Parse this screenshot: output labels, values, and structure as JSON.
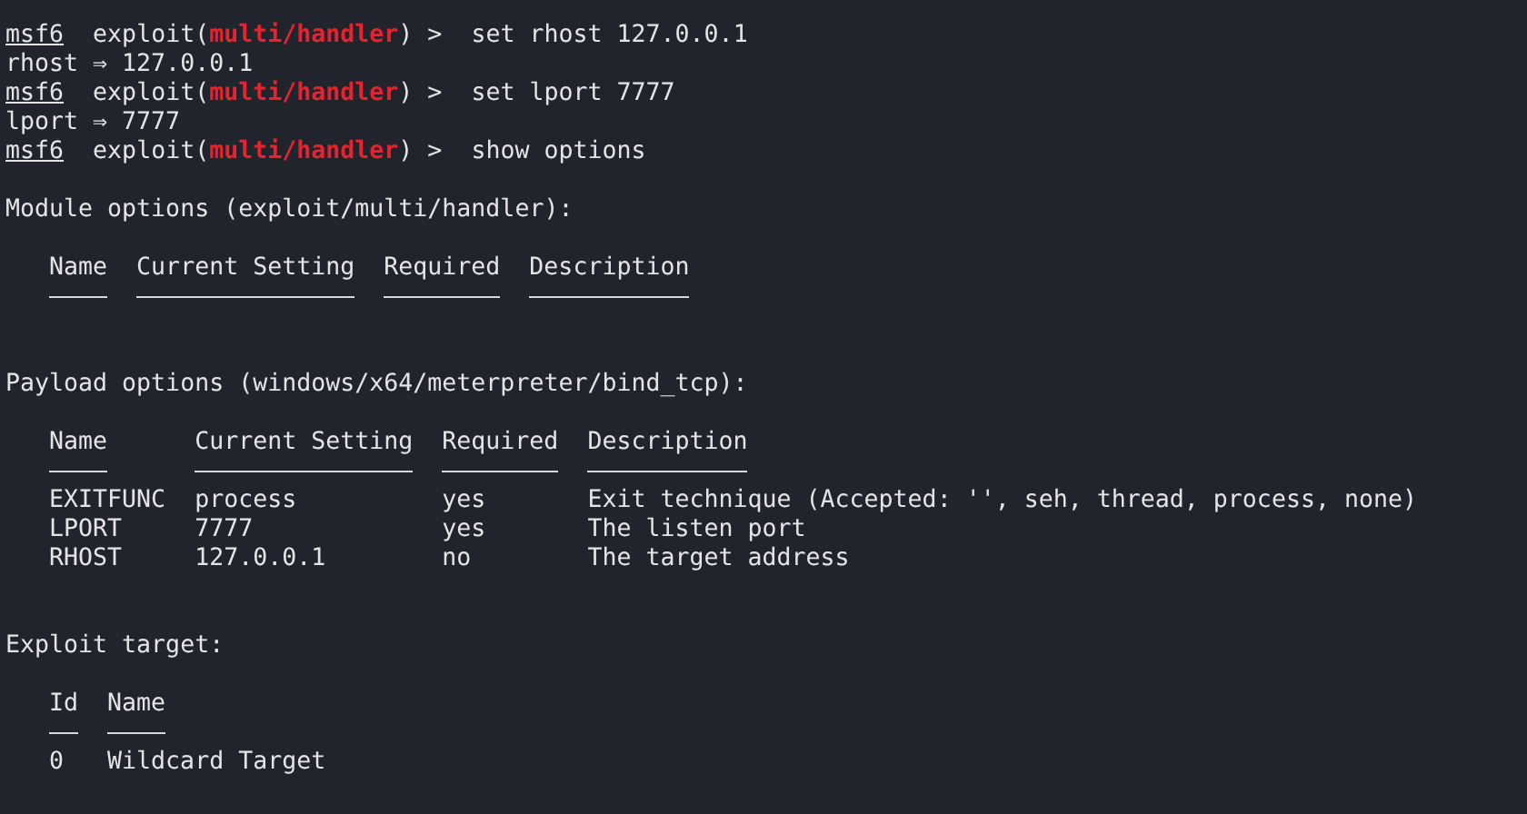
{
  "history": [
    {
      "kind": "prompt",
      "prompt": "msf6",
      "context_open": "exploit(",
      "module": "multi/handler",
      "context_close": ") >",
      "command": "set rhost 127.0.0.1"
    },
    {
      "kind": "output",
      "text": "rhost ⇒ 127.0.0.1"
    },
    {
      "kind": "prompt",
      "prompt": "msf6",
      "context_open": "exploit(",
      "module": "multi/handler",
      "context_close": ") >",
      "command": "set lport 7777"
    },
    {
      "kind": "output",
      "text": "lport ⇒ 7777"
    },
    {
      "kind": "prompt",
      "prompt": "msf6",
      "context_open": "exploit(",
      "module": "multi/handler",
      "context_close": ") >",
      "command": "show options"
    }
  ],
  "sections": [
    {
      "title": "Module options (exploit/multi/handler):",
      "columns": [
        {
          "label": "Name"
        },
        {
          "label": "Current Setting"
        },
        {
          "label": "Required"
        },
        {
          "label": "Description"
        }
      ]
    },
    {
      "title": "Payload options (windows/x64/meterpreter/bind_tcp):",
      "columns": [
        {
          "label": "Name"
        },
        {
          "label": "Current Setting"
        },
        {
          "label": "Required"
        },
        {
          "label": "Description"
        }
      ],
      "rows": [
        [
          "EXITFUNC",
          "process",
          "yes",
          "Exit technique (Accepted: '', seh, thread, process, none)"
        ],
        [
          "LPORT",
          "7777",
          "yes",
          "The listen port"
        ],
        [
          "RHOST",
          "127.0.0.1",
          "no",
          "The target address"
        ]
      ]
    },
    {
      "title": "Exploit target:",
      "columns": [
        {
          "label": "Id"
        },
        {
          "label": "Name"
        }
      ],
      "rows": [
        [
          "0",
          "Wildcard Target"
        ]
      ]
    }
  ]
}
